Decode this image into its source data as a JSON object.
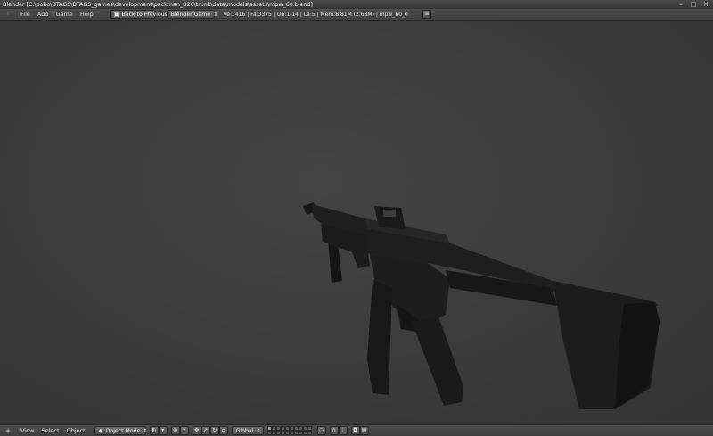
{
  "window": {
    "title": "Blender [C:\\bobo\\BTAGS\\BTAGS_games\\development\\packman_B26\\trunk\\data\\models\\assets\\mpw_60.blend]",
    "controls": [
      "–",
      "□",
      "✕"
    ]
  },
  "header": {
    "editor_icon": "info-editor-icon",
    "menus": [
      "File",
      "Add",
      "Game",
      "Help"
    ],
    "back_button": "Back to Previous",
    "engine": "Blender Game",
    "stats": "Ve:3416 | Fa:3375 | Ob:1-14 | La:5 | Mem:8.81M (2.68M) | mpw_60_0"
  },
  "view3d_header": {
    "menus": [
      "View",
      "Select",
      "Object"
    ],
    "mode": "Object Mode",
    "orientation": "Global"
  },
  "colors": {
    "background": "#3c3c3c",
    "header": "#464646",
    "model": "#1c1c1c"
  }
}
